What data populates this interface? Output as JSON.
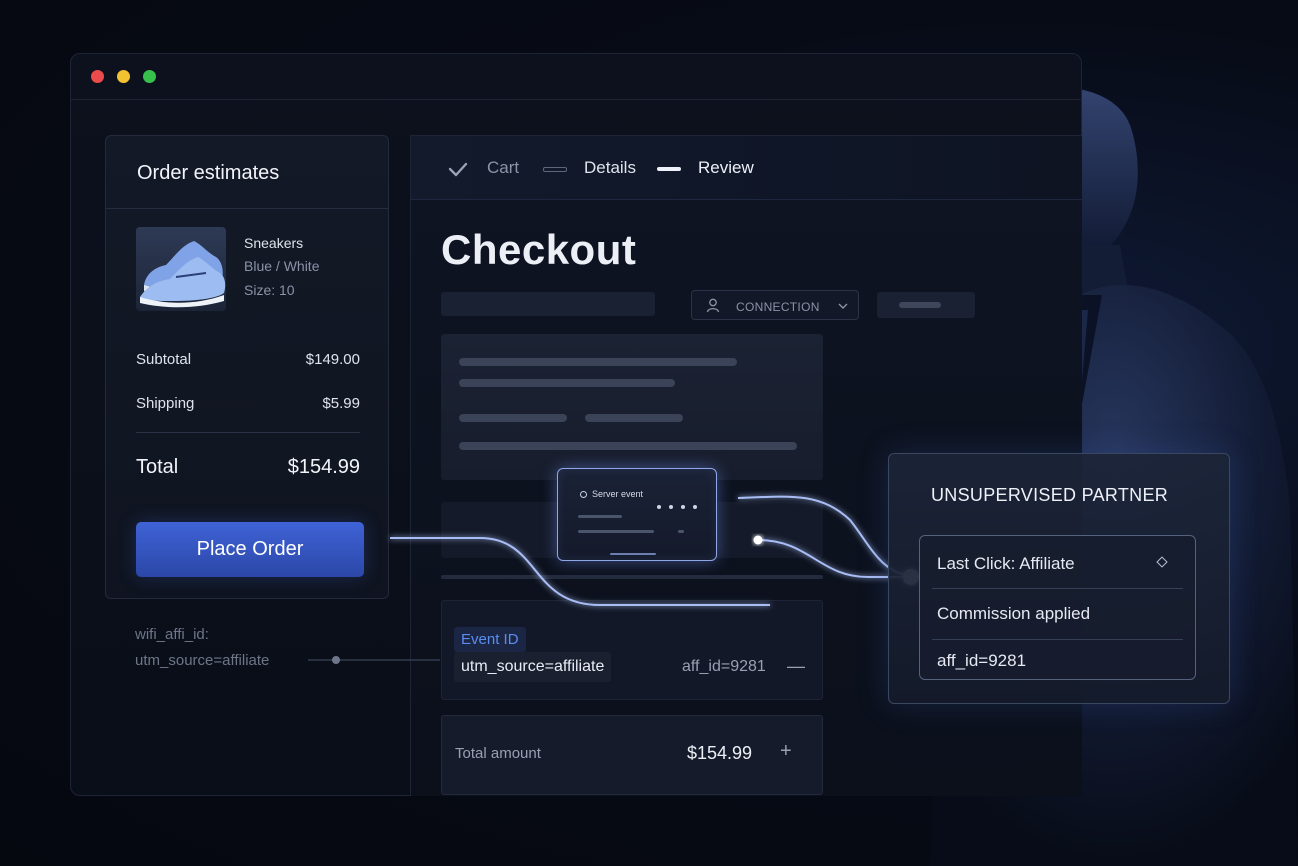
{
  "order": {
    "title": "Order estimates",
    "product": {
      "name": "Sneakers",
      "color": "Blue / White",
      "size": "Size: 10",
      "image_icon": "sneaker-image"
    },
    "subtotal_label": "Subtotal",
    "subtotal_value": "$149.00",
    "shipping_label": "Shipping",
    "shipping_value": "$5.99",
    "total_label": "Total",
    "total_value": "$154.99",
    "place_order_label": "Place Order"
  },
  "params": {
    "line1": "wifi_affi_id:",
    "line2": "utm_source=affiliate"
  },
  "stepper": {
    "steps": [
      {
        "label": "Cart",
        "state": "done"
      },
      {
        "label": "Details",
        "state": "pending"
      },
      {
        "label": "Review",
        "state": "active"
      }
    ]
  },
  "checkout": {
    "title": "Checkout",
    "connection_label": "CONNECTION",
    "server_event_label": "Server event",
    "event_tag": "Event ID",
    "utm_value": "utm_source=affiliate",
    "aff_value": "aff_id=9281",
    "total_amount_label": "Total amount",
    "total_amount_value": "$154.99"
  },
  "partner": {
    "title": "UNSUPERVISED PARTNER",
    "rows": [
      "Last Click: Affiliate",
      "Commission applied",
      "aff_id=9281"
    ]
  },
  "colors": {
    "accent": "#3f63d6",
    "glow": "#a9bdf5",
    "background": "#070b16"
  }
}
